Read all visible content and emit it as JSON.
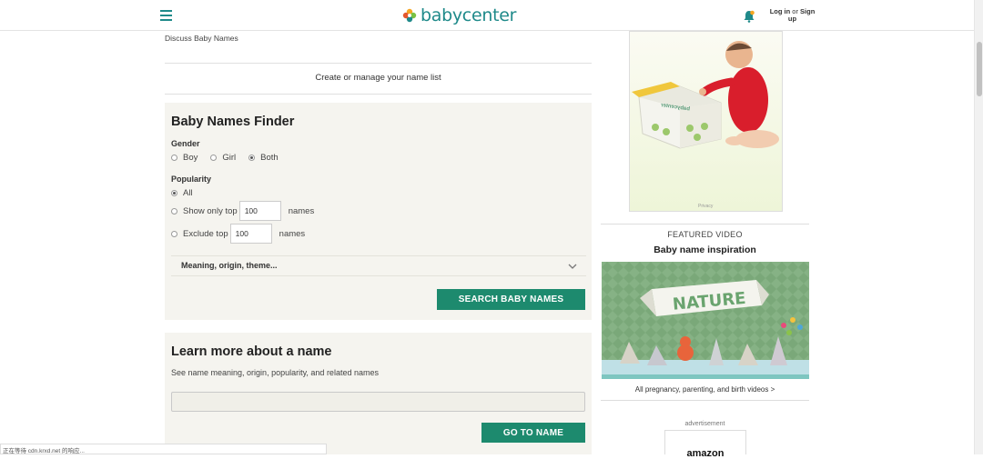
{
  "header": {
    "logo_text": "babycenter",
    "auth_login": "Log in",
    "auth_or": "or",
    "auth_signup": "Sign up"
  },
  "links": {
    "discuss": "Discuss Baby Names",
    "manage": "Create or manage your name list"
  },
  "finder": {
    "title": "Baby Names Finder",
    "gender_label": "Gender",
    "gender_options": [
      "Boy",
      "Girl",
      "Both"
    ],
    "gender_selected": "Both",
    "popularity_label": "Popularity",
    "popularity_all": "All",
    "show_only_top": "Show only top",
    "show_only_value": "100",
    "names_word": "names",
    "exclude_top": "Exclude top",
    "exclude_value": "100",
    "meaning_label": "Meaning, origin, theme...",
    "search_button": "SEARCH BABY NAMES"
  },
  "learn": {
    "title": "Learn more about a name",
    "subtitle": "See name meaning, origin, popularity, and related names",
    "input_value": "",
    "go_button": "GO TO NAME"
  },
  "sidebar": {
    "ad_privacy": "Privacy",
    "ad_box_text": "babycenter",
    "featured_label": "FEATURED VIDEO",
    "featured_title": "Baby name inspiration",
    "video_banner": "NATURE",
    "all_videos": "All pregnancy, parenting, and birth videos >",
    "advertisement": "advertisement",
    "amazon": "amazon"
  },
  "status_bar": "正在等待 cdn.krxd.net 的响应...",
  "colors": {
    "brand_teal": "#1f8a8a",
    "button_green": "#1d8a6e",
    "panel_bg": "#f5f4ef"
  }
}
